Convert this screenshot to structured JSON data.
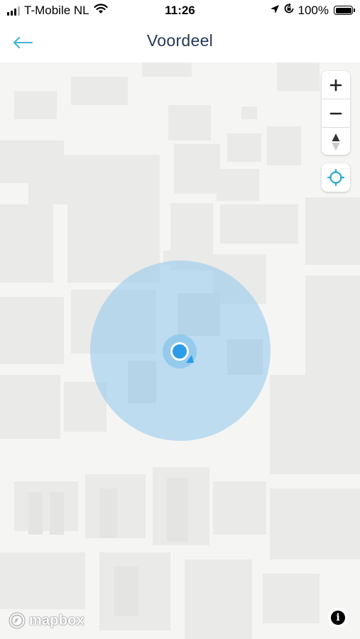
{
  "status_bar": {
    "carrier": "T-Mobile NL",
    "time": "11:26",
    "battery": "100%",
    "battery_level": 1.0,
    "icons": [
      "signal-icon",
      "wifi-icon",
      "location-arrow-icon",
      "orientation-lock-icon",
      "battery-icon"
    ]
  },
  "header": {
    "title": "Voordeel",
    "back_icon": "arrow-left-icon"
  },
  "map": {
    "attribution_logo": "mapbox",
    "controls": [
      "zoom-in",
      "zoom-out",
      "compass",
      "locate-me",
      "info"
    ],
    "colors": {
      "background": "#f5f5f4",
      "buildings": "#e9e9e8",
      "accuracy_circle": "#85c4ec",
      "user_dot": "#2b9ce8",
      "accent": "#3ab6d6"
    }
  }
}
